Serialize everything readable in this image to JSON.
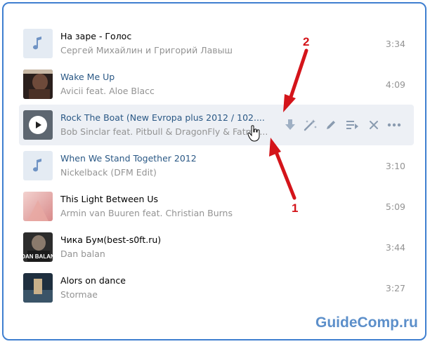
{
  "tracks": [
    {
      "title": "На заре - Голос",
      "artist": "Сергей Михайлин и Григорий Лавыш",
      "duration": "3:34",
      "cover": "music-note-icon"
    },
    {
      "title": "Wake Me Up",
      "artist": "Avicii feat. Aloe Blacc",
      "duration": "4:09",
      "cover": "album-art"
    },
    {
      "title": "Rock The Boat (New Evropa plus 2012 / 102....",
      "artist": "Bob Sinclar feat. Pitbull & DragonFly & Fatma...",
      "duration": "",
      "cover": "play-icon"
    },
    {
      "title": "When We Stand Together 2012",
      "artist": "Nickelback (DFM Edit)",
      "duration": "3:10",
      "cover": "music-note-icon"
    },
    {
      "title": "This Light Between Us",
      "artist": "Armin van Buuren feat. Christian Burns",
      "duration": "5:09",
      "cover": "album-art"
    },
    {
      "title": "Чика Бум(best-s0ft.ru)",
      "artist": "Dan balan",
      "duration": "3:44",
      "cover": "album-art"
    },
    {
      "title": "Alors on dance",
      "artist": "Stormae",
      "duration": "3:27",
      "cover": "album-art"
    }
  ],
  "row_actions": [
    "download-icon",
    "magic-wand-icon",
    "edit-icon",
    "add-to-playlist-icon",
    "delete-icon",
    "more-icon"
  ],
  "annotations": {
    "label_1": "1",
    "label_2": "2"
  },
  "cover_art": {
    "dan_balan_text": "DAN BALAN"
  },
  "watermark": "GuideComp.ru",
  "colors": {
    "link": "#2a5885",
    "annotation_red": "#d4141a",
    "frame_blue": "#3f7fd0",
    "watermark": "#5c8fca",
    "active_row": "#edf0f5"
  }
}
